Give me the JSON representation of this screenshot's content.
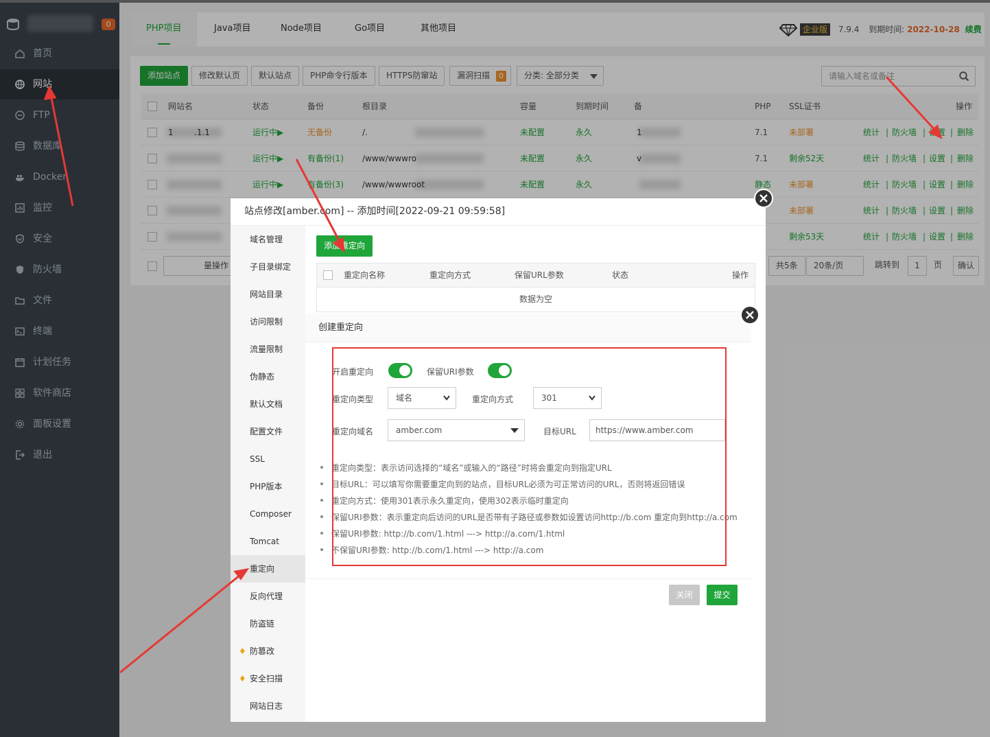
{
  "sidebar": {
    "badge": "0",
    "items": [
      {
        "label": "首页",
        "icon": "home-icon"
      },
      {
        "label": "网站",
        "icon": "globe-icon"
      },
      {
        "label": "FTP",
        "icon": "ftp-icon"
      },
      {
        "label": "数据库",
        "icon": "database-icon"
      },
      {
        "label": "Docker",
        "icon": "docker-icon"
      },
      {
        "label": "监控",
        "icon": "monitor-icon"
      },
      {
        "label": "安全",
        "icon": "shield-icon"
      },
      {
        "label": "防火墙",
        "icon": "firewall-icon"
      },
      {
        "label": "文件",
        "icon": "folder-icon"
      },
      {
        "label": "终端",
        "icon": "terminal-icon"
      },
      {
        "label": "计划任务",
        "icon": "calendar-icon"
      },
      {
        "label": "软件商店",
        "icon": "apps-icon"
      },
      {
        "label": "面板设置",
        "icon": "gear-icon"
      },
      {
        "label": "退出",
        "icon": "logout-icon"
      }
    ]
  },
  "tabs": [
    "PHP项目",
    "Java项目",
    "Node项目",
    "Go项目",
    "其他项目"
  ],
  "version": {
    "edition": "企业版",
    "number": "7.9.4",
    "expire_label": "到期时间:",
    "expire_date": "2022-10-28",
    "renew": "续费"
  },
  "toolbar": {
    "add_site": "添加站点",
    "edit_default": "修改默认页",
    "default_site": "默认站点",
    "php_cli": "PHP命令行版本",
    "https": "HTTPS防窜站",
    "vuln_scan": "漏洞扫描",
    "vuln_count": "0",
    "category": "分类: 全部分类",
    "search_placeholder": "请输入域名或备注"
  },
  "table": {
    "headers": {
      "name": "网站名",
      "status": "状态",
      "backup": "备份",
      "root": "根目录",
      "quota": "容量",
      "expire": "到期时间",
      "remark": "备",
      "php": "PHP",
      "ssl": "SSL证书",
      "ops": "操作"
    },
    "rows": [
      {
        "name": "1",
        "name2": ".1.1",
        "status": "运行中▶",
        "backup": "无备份",
        "root": "/.",
        "quota": "未配置",
        "expire": "永久",
        "remark": "1",
        "php": "7.1",
        "ssl": "未部署"
      },
      {
        "name": "",
        "name2": "",
        "status": "运行中▶",
        "backup": "有备份(1)",
        "root": "/www/wwwro",
        "quota": "未配置",
        "expire": "永久",
        "remark": "v",
        "php": "7.1",
        "ssl": "剩余52天"
      },
      {
        "name": "",
        "name2": "",
        "status": "运行中▶",
        "backup": "有备份(3)",
        "root": "/www/wwwroot",
        "quota": "未配置",
        "expire": "永久",
        "remark": "",
        "php": "静态",
        "ssl": "未部署"
      },
      {
        "name": "",
        "name2": "",
        "status": "",
        "backup": "",
        "root": "",
        "quota": "",
        "expire": "",
        "remark": "",
        "php": "",
        "ssl": "未部署"
      },
      {
        "name": "",
        "name2": "",
        "status": "",
        "backup": "",
        "root": "",
        "quota": "",
        "expire": "",
        "remark": "",
        "php": "",
        "ssl": "剩余53天"
      }
    ],
    "ops": {
      "stats": "统计",
      "firewall": "防火墙",
      "settings": "设置",
      "delete": "删除",
      "sep": "|"
    }
  },
  "pagination": {
    "batch": "量操作",
    "total": "共5条",
    "per_page": "20条/页",
    "jump": "跳转到",
    "page": "1",
    "page_unit": "页",
    "confirm": "确认"
  },
  "modal1": {
    "title": "站点修改[amber.com] -- 添加时间[2022-09-21 09:59:58]",
    "menu": [
      "域名管理",
      "子目录绑定",
      "网站目录",
      "访问限制",
      "流量限制",
      "伪静态",
      "默认文档",
      "配置文件",
      "SSL",
      "PHP版本",
      "Composer",
      "Tomcat",
      "重定向",
      "反向代理",
      "防盗链",
      "防篡改",
      "安全扫描",
      "网站日志"
    ],
    "add_redirect": "添加重定向",
    "headers": {
      "name": "重定向名称",
      "mode": "重定向方式",
      "keep": "保留URL参数",
      "status": "状态",
      "ops": "操作"
    },
    "empty": "数据为空"
  },
  "modal2": {
    "title": "创建重定向",
    "enable_label": "开启重定向",
    "keep_uri_label": "保留URI参数",
    "type_label": "重定向类型",
    "type_value": "域名",
    "mode_label": "重定向方式",
    "mode_value": "301",
    "domain_label": "重定向域名",
    "domain_value": "amber.com",
    "target_label": "目标URL",
    "target_value": "https://www.amber.com",
    "tips": [
      "重定向类型：表示访问选择的“域名”或输入的“路径”时将会重定向到指定URL",
      "目标URL：可以填写你需要重定向到的站点，目标URL必须为可正常访问的URL，否则将返回错误",
      "重定向方式：使用301表示永久重定向，使用302表示临时重定向",
      "保留URI参数：表示重定向后访问的URL是否带有子路径或参数如设置访问http://b.com 重定向到http://a.com",
      "保留URI参数:  http://b.com/1.html ---> http://a.com/1.html",
      "不保留URI参数: http://b.com/1.html ---> http://a.com"
    ],
    "close_btn": "关闭",
    "submit_btn": "提交"
  },
  "colors": {
    "accent": "#20a53a",
    "sidebar": "#3c444d",
    "warning": "#f0922e",
    "annotation": "#e53935"
  }
}
